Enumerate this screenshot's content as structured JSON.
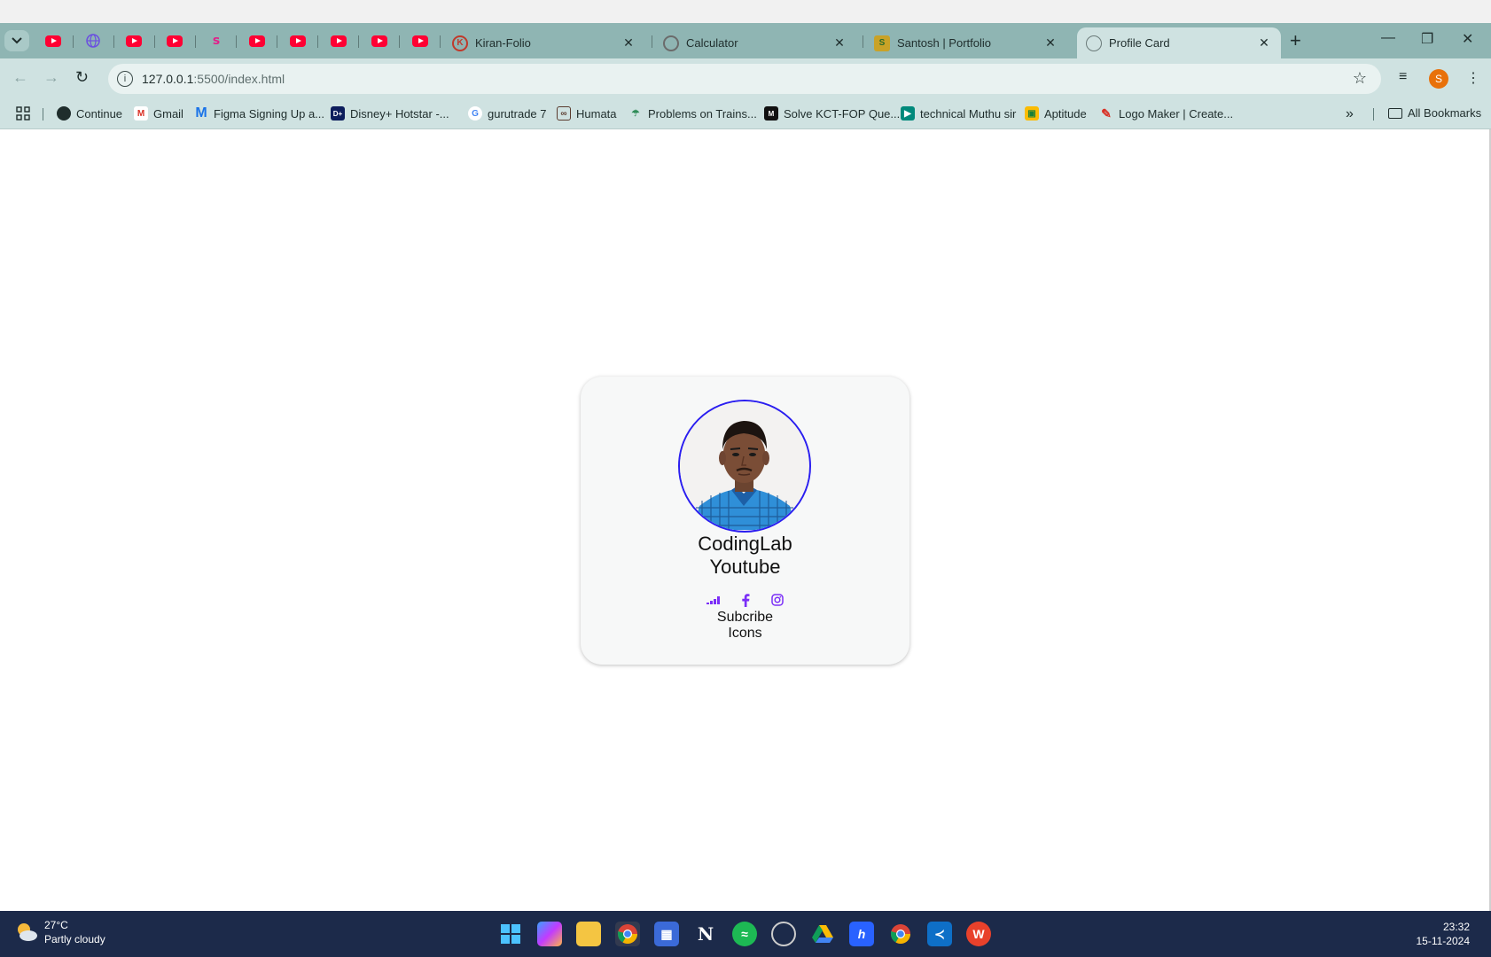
{
  "browser": {
    "tabs": [
      {
        "title": "Kiran-Folio",
        "favicon": "kiran-folio-icon"
      },
      {
        "title": "Calculator",
        "favicon": "calculator-icon"
      },
      {
        "title": "Santosh | Portfolio",
        "favicon": "portfolio-icon"
      },
      {
        "title": "Profile Card",
        "favicon": "globe-icon",
        "active": true
      }
    ],
    "pinned_tab_icons": [
      "youtube-icon",
      "globe-icon",
      "youtube-icon",
      "youtube-icon",
      "s-icon",
      "youtube-icon",
      "youtube-icon",
      "youtube-icon",
      "youtube-icon",
      "youtube-icon"
    ],
    "address": {
      "host": "127.0.0.1",
      "rest": ":5500/index.html"
    },
    "profile_initial": "S",
    "bookmarks": [
      {
        "label": "Continue",
        "icon": "continue-icon"
      },
      {
        "label": "Gmail",
        "icon": "gmail-icon"
      },
      {
        "label": "Figma Signing Up a...",
        "icon": "figma-icon"
      },
      {
        "label": "Disney+ Hotstar -...",
        "icon": "hotstar-icon"
      },
      {
        "label": "gurutrade 7",
        "icon": "google-icon"
      },
      {
        "label": "Humata",
        "icon": "humata-icon"
      },
      {
        "label": "Problems on Trains...",
        "icon": "trains-icon"
      },
      {
        "label": "Solve KCT-FOP Que...",
        "icon": "kct-icon"
      },
      {
        "label": "technical Muthu sir",
        "icon": "meet-icon"
      },
      {
        "label": "Aptitude",
        "icon": "classroom-icon"
      },
      {
        "label": "Logo Maker | Create...",
        "icon": "logo-maker-icon"
      }
    ],
    "all_bookmarks_label": "All Bookmarks",
    "colors": {
      "tabbar": "#8fb5b3",
      "toolbar": "#cfe2e1"
    }
  },
  "card": {
    "name_line1": "CodingLab",
    "name_line2": "Youtube",
    "social_icons": [
      "deezer-icon",
      "facebook-icon",
      "instagram-icon"
    ],
    "subtitle_line1": "Subcribe",
    "subtitle_line2": "Icons",
    "colors": {
      "photo_border": "#2a1ef0",
      "icon": "#7b2ff7"
    }
  },
  "taskbar": {
    "weather_temp": "27°C",
    "weather_condition": "Partly cloudy",
    "time": "23:32",
    "date": "15-11-2024",
    "apps": [
      "windows-start-icon",
      "copilot-icon",
      "file-explorer-icon",
      "chrome-icon",
      "store-icon",
      "notion-icon",
      "spotify-icon",
      "obs-icon",
      "google-drive-icon",
      "hashnode-icon",
      "chrome-icon",
      "vscode-icon",
      "wps-icon"
    ]
  }
}
